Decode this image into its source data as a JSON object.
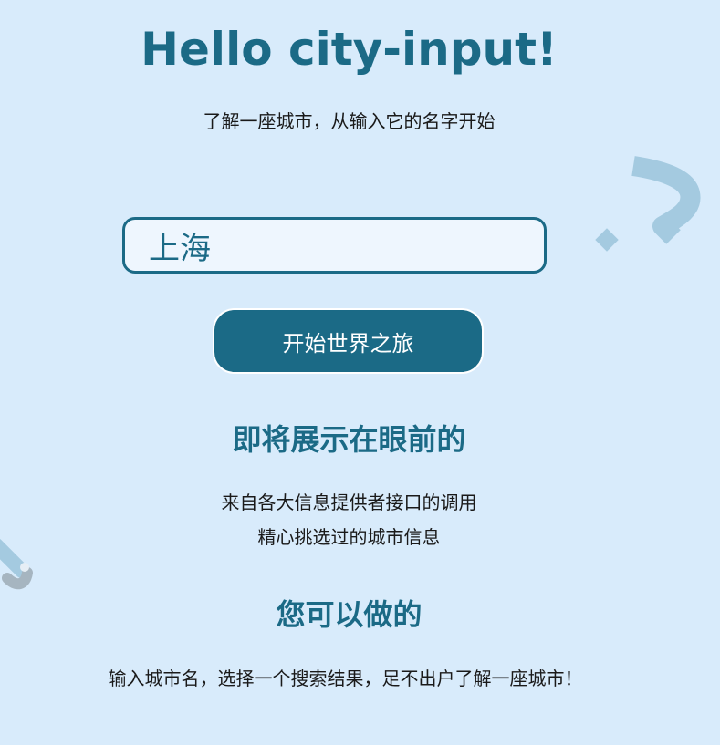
{
  "header": {
    "title": "Hello city-input!",
    "subtitle": "了解一座城市，从输入它的名字开始"
  },
  "search": {
    "value": "上海",
    "placeholder": ""
  },
  "actions": {
    "start_label": "开始世界之旅"
  },
  "preview_section": {
    "heading": "即将展示在眼前的",
    "line1": "来自各大信息提供者接口的调用",
    "line2": "精心挑选过的城市信息"
  },
  "action_section": {
    "heading": "您可以做的",
    "line": "输入城市名，选择一个搜索结果，足不出户了解一座城市！"
  },
  "decorations": {
    "top_right": "question-mark-icon",
    "bottom_left": "tube-icon"
  },
  "colors": {
    "background": "#d8ebfb",
    "accent": "#1b6a86",
    "input_bg": "#eef6fe",
    "deco_blue": "#a4cae0",
    "deco_gray": "#a6b5c0"
  }
}
